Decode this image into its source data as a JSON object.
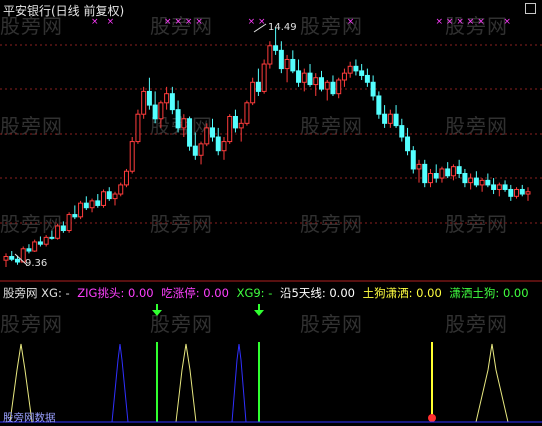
{
  "header": {
    "title": "平安银行(日线 前复权)"
  },
  "price_chart": {
    "high_label": "14.49",
    "low_label": "9.36",
    "colors": {
      "up": "#ff3c3c",
      "down": "#54ffff",
      "markers": "#ff3cff"
    },
    "candles": [
      [
        9.4,
        9.55,
        9.25,
        9.48
      ],
      [
        9.48,
        9.6,
        9.38,
        9.42
      ],
      [
        9.42,
        9.5,
        9.3,
        9.36
      ],
      [
        9.36,
        9.7,
        9.36,
        9.65
      ],
      [
        9.65,
        9.75,
        9.55,
        9.6
      ],
      [
        9.6,
        9.85,
        9.58,
        9.8
      ],
      [
        9.8,
        9.92,
        9.7,
        9.75
      ],
      [
        9.75,
        9.95,
        9.7,
        9.9
      ],
      [
        9.9,
        10.05,
        9.85,
        9.88
      ],
      [
        9.88,
        10.2,
        9.85,
        10.15
      ],
      [
        10.15,
        10.25,
        10.0,
        10.05
      ],
      [
        10.05,
        10.45,
        10.0,
        10.4
      ],
      [
        10.4,
        10.6,
        10.3,
        10.35
      ],
      [
        10.35,
        10.7,
        10.3,
        10.65
      ],
      [
        10.65,
        10.8,
        10.5,
        10.55
      ],
      [
        10.55,
        10.75,
        10.45,
        10.7
      ],
      [
        10.7,
        10.85,
        10.55,
        10.6
      ],
      [
        10.6,
        10.95,
        10.55,
        10.9
      ],
      [
        10.9,
        11.0,
        10.7,
        10.75
      ],
      [
        10.75,
        10.9,
        10.6,
        10.85
      ],
      [
        10.85,
        11.1,
        10.8,
        11.05
      ],
      [
        11.05,
        11.4,
        11.0,
        11.35
      ],
      [
        11.35,
        12.1,
        11.3,
        12.0
      ],
      [
        12.0,
        12.7,
        11.95,
        12.6
      ],
      [
        12.6,
        13.2,
        12.5,
        13.1
      ],
      [
        13.1,
        13.4,
        12.7,
        12.8
      ],
      [
        12.8,
        13.1,
        12.4,
        12.5
      ],
      [
        12.5,
        12.9,
        12.3,
        12.85
      ],
      [
        12.85,
        13.2,
        12.7,
        13.05
      ],
      [
        13.05,
        13.2,
        12.6,
        12.7
      ],
      [
        12.7,
        12.9,
        12.2,
        12.3
      ],
      [
        12.3,
        12.6,
        12.1,
        12.5
      ],
      [
        12.5,
        12.55,
        11.8,
        11.9
      ],
      [
        11.9,
        12.2,
        11.6,
        11.7
      ],
      [
        11.7,
        12.0,
        11.5,
        11.95
      ],
      [
        11.95,
        12.4,
        11.9,
        12.3
      ],
      [
        12.3,
        12.5,
        12.0,
        12.1
      ],
      [
        12.1,
        12.3,
        11.7,
        11.8
      ],
      [
        11.8,
        12.1,
        11.6,
        12.0
      ],
      [
        12.0,
        12.6,
        11.95,
        12.55
      ],
      [
        12.55,
        12.7,
        12.2,
        12.3
      ],
      [
        12.3,
        12.5,
        12.0,
        12.4
      ],
      [
        12.4,
        12.9,
        12.35,
        12.85
      ],
      [
        12.85,
        13.4,
        12.8,
        13.3
      ],
      [
        13.3,
        13.6,
        13.0,
        13.1
      ],
      [
        13.1,
        13.8,
        13.05,
        13.7
      ],
      [
        13.7,
        14.2,
        13.6,
        14.1
      ],
      [
        14.1,
        14.49,
        13.9,
        14.0
      ],
      [
        14.0,
        14.2,
        13.5,
        13.6
      ],
      [
        13.6,
        13.9,
        13.3,
        13.8
      ],
      [
        13.8,
        14.0,
        13.5,
        13.55
      ],
      [
        13.55,
        13.8,
        13.2,
        13.3
      ],
      [
        13.3,
        13.6,
        13.1,
        13.5
      ],
      [
        13.5,
        13.7,
        13.2,
        13.25
      ],
      [
        13.25,
        13.5,
        13.0,
        13.4
      ],
      [
        13.4,
        13.55,
        13.1,
        13.15
      ],
      [
        13.15,
        13.35,
        12.9,
        13.3
      ],
      [
        13.3,
        13.45,
        13.0,
        13.05
      ],
      [
        13.05,
        13.4,
        12.95,
        13.35
      ],
      [
        13.35,
        13.6,
        13.2,
        13.5
      ],
      [
        13.5,
        13.75,
        13.4,
        13.65
      ],
      [
        13.65,
        13.8,
        13.45,
        13.55
      ],
      [
        13.55,
        13.7,
        13.35,
        13.45
      ],
      [
        13.45,
        13.6,
        13.2,
        13.3
      ],
      [
        13.3,
        13.45,
        12.9,
        13.0
      ],
      [
        13.0,
        13.1,
        12.5,
        12.6
      ],
      [
        12.6,
        12.8,
        12.3,
        12.4
      ],
      [
        12.4,
        12.7,
        12.3,
        12.6
      ],
      [
        12.6,
        12.8,
        12.3,
        12.35
      ],
      [
        12.35,
        12.5,
        12.0,
        12.1
      ],
      [
        12.1,
        12.3,
        11.7,
        11.8
      ],
      [
        11.8,
        11.9,
        11.3,
        11.4
      ],
      [
        11.4,
        11.6,
        11.1,
        11.5
      ],
      [
        11.5,
        11.6,
        11.0,
        11.1
      ],
      [
        11.1,
        11.4,
        11.0,
        11.3
      ],
      [
        11.3,
        11.5,
        11.1,
        11.2
      ],
      [
        11.2,
        11.45,
        11.1,
        11.4
      ],
      [
        11.4,
        11.55,
        11.2,
        11.25
      ],
      [
        11.25,
        11.5,
        11.15,
        11.45
      ],
      [
        11.45,
        11.6,
        11.2,
        11.3
      ],
      [
        11.3,
        11.4,
        11.0,
        11.1
      ],
      [
        11.1,
        11.3,
        10.95,
        11.2
      ],
      [
        11.2,
        11.35,
        11.0,
        11.05
      ],
      [
        11.05,
        11.2,
        10.9,
        11.15
      ],
      [
        11.15,
        11.3,
        11.0,
        11.05
      ],
      [
        11.05,
        11.2,
        10.85,
        10.95
      ],
      [
        10.95,
        11.1,
        10.8,
        11.05
      ],
      [
        11.05,
        11.15,
        10.9,
        10.95
      ],
      [
        10.95,
        11.05,
        10.7,
        10.8
      ],
      [
        10.8,
        11.0,
        10.75,
        10.95
      ],
      [
        10.95,
        11.05,
        10.8,
        10.85
      ],
      [
        10.85,
        11.0,
        10.7,
        10.9
      ]
    ],
    "marker_positions": [
      0.17,
      0.2,
      0.31,
      0.33,
      0.35,
      0.37,
      0.47,
      0.49,
      0.66,
      0.83,
      0.85,
      0.87,
      0.89,
      0.91,
      0.96
    ]
  },
  "indicator_bar": {
    "items": [
      {
        "text": "股旁网 XG: -",
        "color": "#e0e0e0"
      },
      {
        "text": "ZIG挑头: 0.00",
        "color": "#ff40ff"
      },
      {
        "text": "吃涨停: 0.00",
        "color": "#ff40ff"
      },
      {
        "text": "XG9: -",
        "color": "#40ff40"
      },
      {
        "text": "沿5天线: 0.00",
        "color": "#ffffff"
      },
      {
        "text": "土狗潇洒: 0.00",
        "color": "#ffff40"
      },
      {
        "text": "潇洒土狗: 0.00",
        "color": "#40ff40"
      }
    ]
  },
  "lower_panel": {
    "bottom_text": "股旁网数据",
    "colors": {
      "zig": "#e8e880",
      "blue": "#3030ff",
      "green": "#30ff30",
      "yellow": "#ffff30"
    }
  },
  "watermark": "股旁网"
}
